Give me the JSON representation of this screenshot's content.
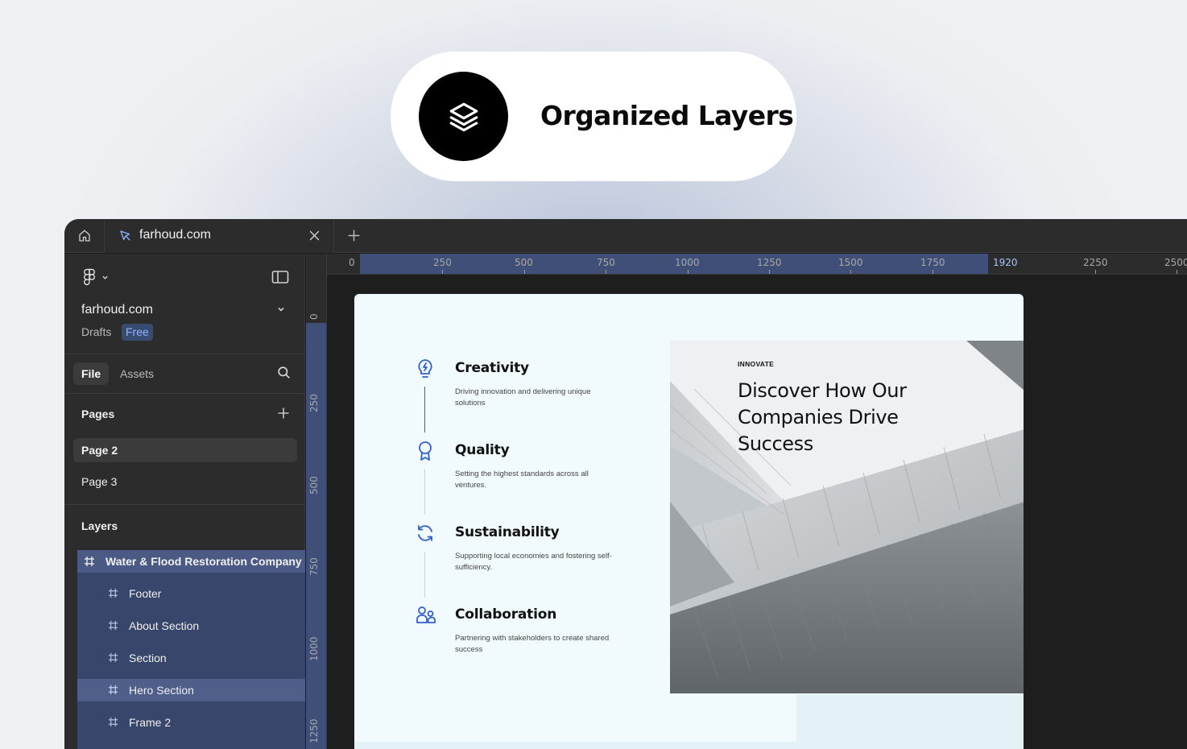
{
  "badge": {
    "title": "Organized Layers",
    "icon": "layers-icon"
  },
  "tabs": {
    "home_icon": "home-icon",
    "active_tab": {
      "label": "farhoud.com",
      "icon": "figma-draft-icon"
    },
    "add_icon": "plus-icon"
  },
  "sidebar": {
    "file_title": "farhoud.com",
    "location": "Drafts",
    "plan_badge": "Free",
    "tabs": {
      "file": "File",
      "assets": "Assets"
    },
    "pages_header": "Pages",
    "pages": [
      {
        "label": "Page 2",
        "active": true
      },
      {
        "label": "Page 3",
        "active": false
      }
    ],
    "layers_header": "Layers",
    "layers": [
      {
        "label": "Water & Flood Restoration Company",
        "level": 0
      },
      {
        "label": "Footer",
        "level": 1
      },
      {
        "label": "About Section",
        "level": 1
      },
      {
        "label": "Section",
        "level": 1
      },
      {
        "label": "Hero Section",
        "level": 1,
        "selected": true
      },
      {
        "label": "Frame 2",
        "level": 1
      }
    ]
  },
  "rulers": {
    "top": [
      "0",
      "250",
      "500",
      "750",
      "1000",
      "1250",
      "1500",
      "1750",
      "1920",
      "2250",
      "2500"
    ],
    "left": [
      "0",
      "250",
      "500",
      "750",
      "1000",
      "1250"
    ]
  },
  "design": {
    "features": [
      {
        "title": "Creativity",
        "description": "Driving innovation and delivering unique solutions",
        "icon": "lightbulb-icon"
      },
      {
        "title": "Quality",
        "description": "Setting the highest standards across all ventures.",
        "icon": "award-icon"
      },
      {
        "title": "Sustainability",
        "description": "Supporting local economies and fostering self-sufficiency.",
        "icon": "refresh-icon"
      },
      {
        "title": "Collaboration",
        "description": "Partnering with stakeholders to create shared success",
        "icon": "users-icon"
      }
    ],
    "hero": {
      "kicker": "INNOVATE",
      "title": "Discover How Our Companies Drive Success"
    }
  },
  "colors": {
    "accent": "#3b82f6",
    "icon_blue": "#2f5fd0",
    "selection": "#37466a"
  }
}
